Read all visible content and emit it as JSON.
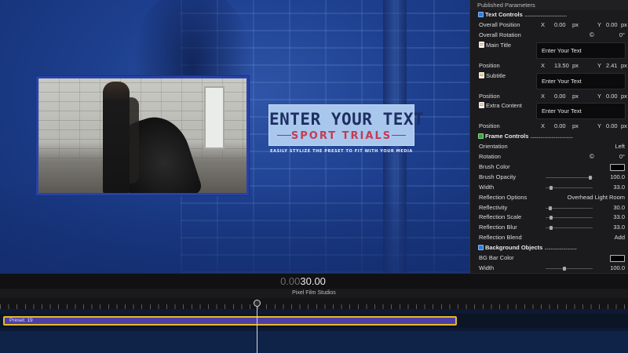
{
  "viewer": {
    "title_main": "ENTER YOUR TEXT",
    "title_sub": "SPORT TRIALS",
    "tagline": "EASILY STYLIZE THE PRESET TO FIT WITH YOUR MEDIA"
  },
  "inspector": {
    "header": "Published Parameters",
    "text_controls": {
      "label": "Text Controls",
      "overall_position": {
        "label": "Overall Position",
        "x_label": "X",
        "x": "0.00",
        "x_unit": "px",
        "y_label": "Y",
        "y": "0.00",
        "y_unit": "px"
      },
      "overall_rotation": {
        "label": "Overall Rotation",
        "value": "0°"
      },
      "main_title": {
        "label": "Main Title",
        "value": "Enter Your Text"
      },
      "main_position": {
        "label": "Position",
        "x_label": "X",
        "x": "13.50",
        "x_unit": "px",
        "y_label": "Y",
        "y": "2.41",
        "y_unit": "px"
      },
      "subtitle": {
        "label": "Subtitle",
        "value": "Enter Your Text"
      },
      "subtitle_position": {
        "label": "Position",
        "x_label": "X",
        "x": "0.00",
        "x_unit": "px",
        "y_label": "Y",
        "y": "0.00",
        "y_unit": "px"
      },
      "extra_content": {
        "label": "Extra Content",
        "value": "Enter Your Text"
      },
      "extra_position": {
        "label": "Position",
        "x_label": "X",
        "x": "0.00",
        "x_unit": "px",
        "y_label": "Y",
        "y": "0.00",
        "y_unit": "px"
      }
    },
    "frame_controls": {
      "label": "Frame Controls",
      "orientation": {
        "label": "Orientation",
        "value": "Left"
      },
      "rotation": {
        "label": "Rotation",
        "value": "0°"
      },
      "brush_color": {
        "label": "Brush Color",
        "color": "#000000"
      },
      "brush_opacity": {
        "label": "Brush Opacity",
        "value": "100.0",
        "level": 0.95
      },
      "width": {
        "label": "Width",
        "value": "33.0",
        "level": 0.12
      },
      "reflection_options": {
        "label": "Reflection Options",
        "value": "Overhead Light Room"
      },
      "reflectivity": {
        "label": "Reflectivity",
        "value": "30.0",
        "level": 0.1
      },
      "reflection_scale": {
        "label": "Reflection Scale",
        "value": "33.0",
        "level": 0.12
      },
      "reflection_blur": {
        "label": "Reflection Blur",
        "value": "33.0",
        "level": 0.12
      },
      "reflection_blend": {
        "label": "Reflection Blend",
        "value": "Add"
      }
    },
    "background_objects": {
      "label": "Background Objects",
      "bg_bar_color": {
        "label": "BG Bar Color",
        "color": "#000000"
      },
      "width": {
        "label": "Width",
        "value": "100.0",
        "level": 0.4
      }
    }
  },
  "timeline": {
    "timecode_dim": "0.00",
    "timecode_bright": "30.00",
    "project_name": "Pixel Film Studios",
    "clip_label": "Preset: 19"
  },
  "colors": {
    "accent_blue": "#2742a8",
    "clip_fill": "#4d3fa6",
    "clip_border": "#e8b72a"
  }
}
